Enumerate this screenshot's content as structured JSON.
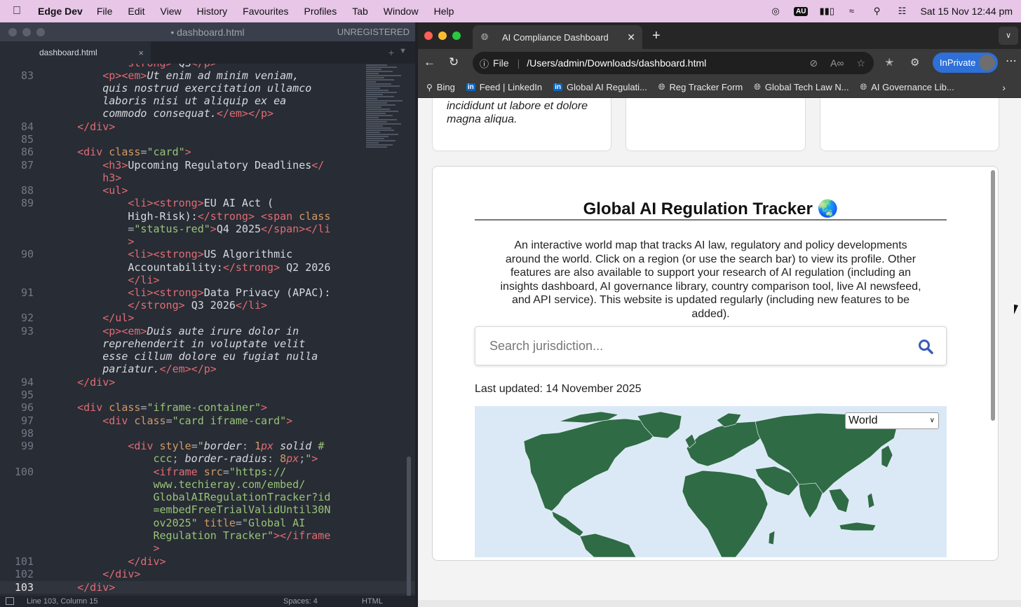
{
  "menubar": {
    "app_name": "Edge Dev",
    "items": [
      "File",
      "Edit",
      "View",
      "History",
      "Favourites",
      "Profiles",
      "Tab",
      "Window",
      "Help"
    ],
    "au_badge": "AU",
    "datetime": "Sat 15 Nov  12:44 pm"
  },
  "editor": {
    "title": "dashboard.html",
    "unregistered": "UNREGISTERED",
    "tab_label": "dashboard.html",
    "status_position": "Line 103, Column 15",
    "status_spaces": "Spaces: 4",
    "status_syntax": "HTML",
    "line_numbers": [
      "83",
      "84",
      "85",
      "86",
      "87",
      "88",
      "89",
      "90",
      "91",
      "92",
      "93",
      "94",
      "95",
      "96",
      "97",
      "98",
      "99",
      "100",
      "101",
      "102",
      "103"
    ]
  },
  "browser": {
    "tab_title": "AI Compliance Dashboard",
    "address_scheme": "File",
    "address_url": "/Users/admin/Downloads/dashboard.html",
    "inprivate_label": "InPrivate",
    "favourites": [
      "Bing",
      "Feed | LinkedIn",
      "Global AI Regulati...",
      "Reg Tracker Form",
      "Global Tech Law N...",
      "AI Governance Lib..."
    ]
  },
  "page": {
    "top_card_text": "incididunt ut labore et dolore magna aliqua.",
    "tracker_title": "Global AI Regulation Tracker 🌏",
    "tracker_desc": "An interactive world map that tracks AI law, regulatory and policy developments around the world. Click on a region (or use the search bar) to view its profile. Other features are also available to support your research of AI regulation (including an insights dashboard, AI governance library, country comparison tool, live AI newsfeed, and API service). This website is updated regularly (including new features to be added).",
    "search_placeholder": "Search jurisdiction...",
    "last_updated": "Last updated: 14 November 2025",
    "region_select": "World"
  },
  "colors": {
    "menubar_bg": "#e7c6e8",
    "editor_bg": "#282c34",
    "inprivate_blue": "#2e6fd8",
    "map_land": "#2f6b45",
    "map_water": "#dbe9f6",
    "search_icon": "#3b5bb5"
  }
}
